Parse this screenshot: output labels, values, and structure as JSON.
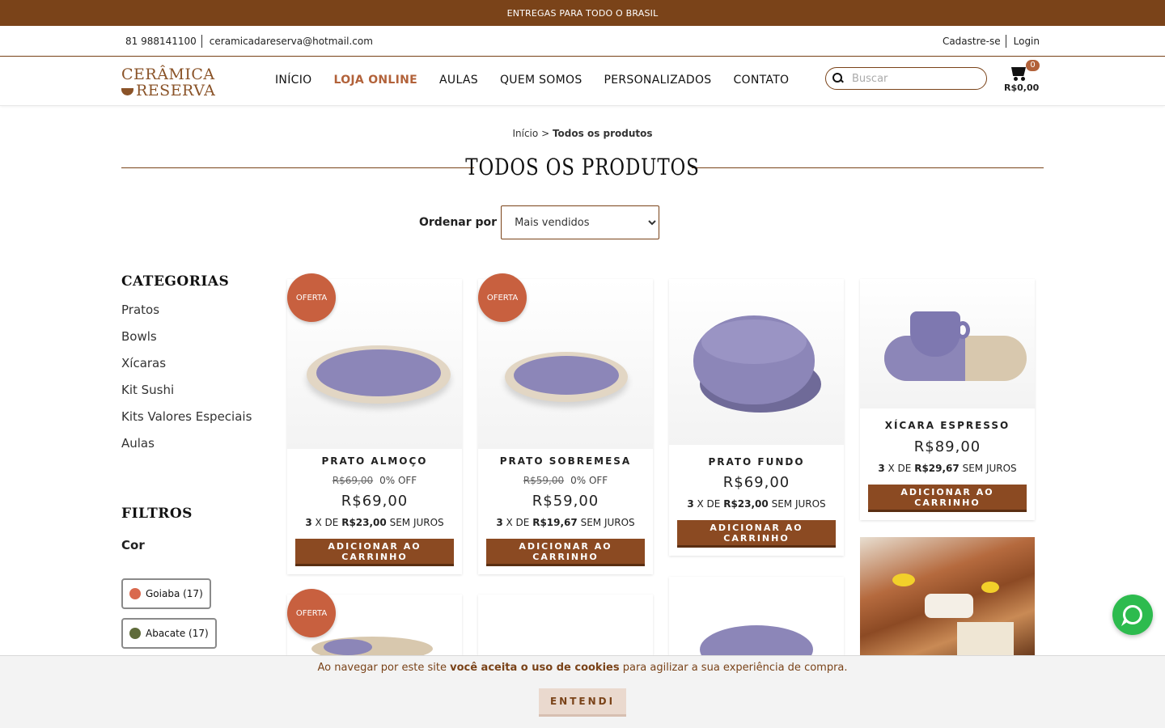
{
  "topbar": {
    "text": "ENTREGAS PARA TODO O BRASIL"
  },
  "contact": {
    "phone": "81 988141100",
    "email": "ceramicadareserva@hotmail.com",
    "register": "Cadastre-se",
    "login": "Login"
  },
  "logo": {
    "line1": "CERÂMICA",
    "line2": "RESERVA"
  },
  "nav": {
    "items": [
      "INÍCIO",
      "LOJA ONLINE",
      "AULAS",
      "QUEM SOMOS",
      "PERSONALIZADOS",
      "CONTATO"
    ],
    "active": "LOJA ONLINE"
  },
  "search": {
    "placeholder": "Buscar",
    "icon": "search-icon"
  },
  "cart": {
    "count": "0",
    "total": "R$0,00",
    "icon": "cart-icon"
  },
  "breadcrumb": {
    "home": "Início",
    "separator": ">",
    "current": "Todos os produtos"
  },
  "page": {
    "title": "TODOS OS PRODUTOS"
  },
  "sort": {
    "label": "Ordenar por",
    "selected": "Mais vendidos"
  },
  "sidebar": {
    "categories_title": "CATEGORIAS",
    "categories": [
      "Pratos",
      "Bowls",
      "Xícaras",
      "Kit Sushi",
      "Kits Valores Especiais",
      "Aulas"
    ],
    "filters_title": "FILTROS",
    "color_label": "Cor",
    "colors": [
      {
        "label": "Goiaba (17)",
        "swatch": "#d9694e"
      },
      {
        "label": "Abacate (17)",
        "swatch": "#5f6b3a"
      }
    ]
  },
  "products": [
    {
      "badge": "OFERTA",
      "name": "PRATO ALMOÇO",
      "old_price": "R$69,00",
      "discount": "0% OFF",
      "price": "R$69,00",
      "installments_count": "3",
      "installments_mid": "X DE",
      "installment_value": "R$23,00",
      "installments_suffix": "SEM JUROS",
      "button": "ADICIONAR AO CARRINHO"
    },
    {
      "badge": "OFERTA",
      "name": "PRATO SOBREMESA",
      "old_price": "R$59,00",
      "discount": "0% OFF",
      "price": "R$59,00",
      "installments_count": "3",
      "installments_mid": "X DE",
      "installment_value": "R$19,67",
      "installments_suffix": "SEM JUROS",
      "button": "ADICIONAR AO CARRINHO"
    },
    {
      "name": "PRATO FUNDO",
      "price": "R$69,00",
      "installments_count": "3",
      "installments_mid": "X DE",
      "installment_value": "R$23,00",
      "installments_suffix": "SEM JUROS",
      "button": "ADICIONAR AO CARRINHO"
    },
    {
      "name": "XÍCARA ESPRESSO",
      "price": "R$89,00",
      "installments_count": "3",
      "installments_mid": "X DE",
      "installment_value": "R$29,67",
      "installments_suffix": "SEM JUROS",
      "button": "ADICIONAR AO CARRINHO"
    }
  ],
  "second_row": {
    "badge": "OFERTA"
  },
  "cookie": {
    "prefix": "Ao navegar por este site ",
    "bold": "você aceita o uso de cookies",
    "suffix": " para agilizar a sua experiência de compra.",
    "button": "ENTENDI"
  },
  "colors": {
    "brand_brown": "#7a4319",
    "accent_terracotta": "#c8603f",
    "button_brown": "#8b4a22",
    "plate_lavender": "#8c86b8",
    "whatsapp_green": "#2dbb4e"
  }
}
